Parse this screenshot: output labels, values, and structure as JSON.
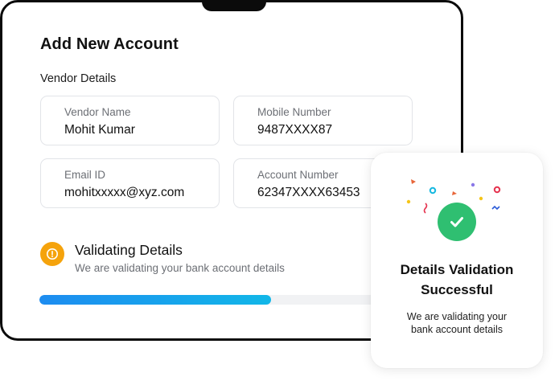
{
  "form": {
    "title": "Add New Account",
    "section_label": "Vendor Details",
    "fields": [
      {
        "label": "Vendor Name",
        "value": "Mohit Kumar"
      },
      {
        "label": "Mobile Number",
        "value": "9487XXXX87"
      },
      {
        "label": "Email ID",
        "value": "mohitxxxxx@xyz.com"
      },
      {
        "label": "Account Number",
        "value": "62347XXXX63453"
      }
    ]
  },
  "status": {
    "icon": "warning-icon",
    "title": "Validating Details",
    "subtitle": "We are validating your bank account details",
    "color": "#f5a30c"
  },
  "progress": {
    "fraction": 0.67,
    "color_start": "#1d8cf0",
    "color_end": "#12b7e8"
  },
  "success_card": {
    "icon": "check-icon",
    "title_line1": "Details Validation",
    "title_line2": "Successful",
    "subtitle_line1": "We are validating your",
    "subtitle_line2": "bank account details",
    "accent": "#2fbf71"
  }
}
